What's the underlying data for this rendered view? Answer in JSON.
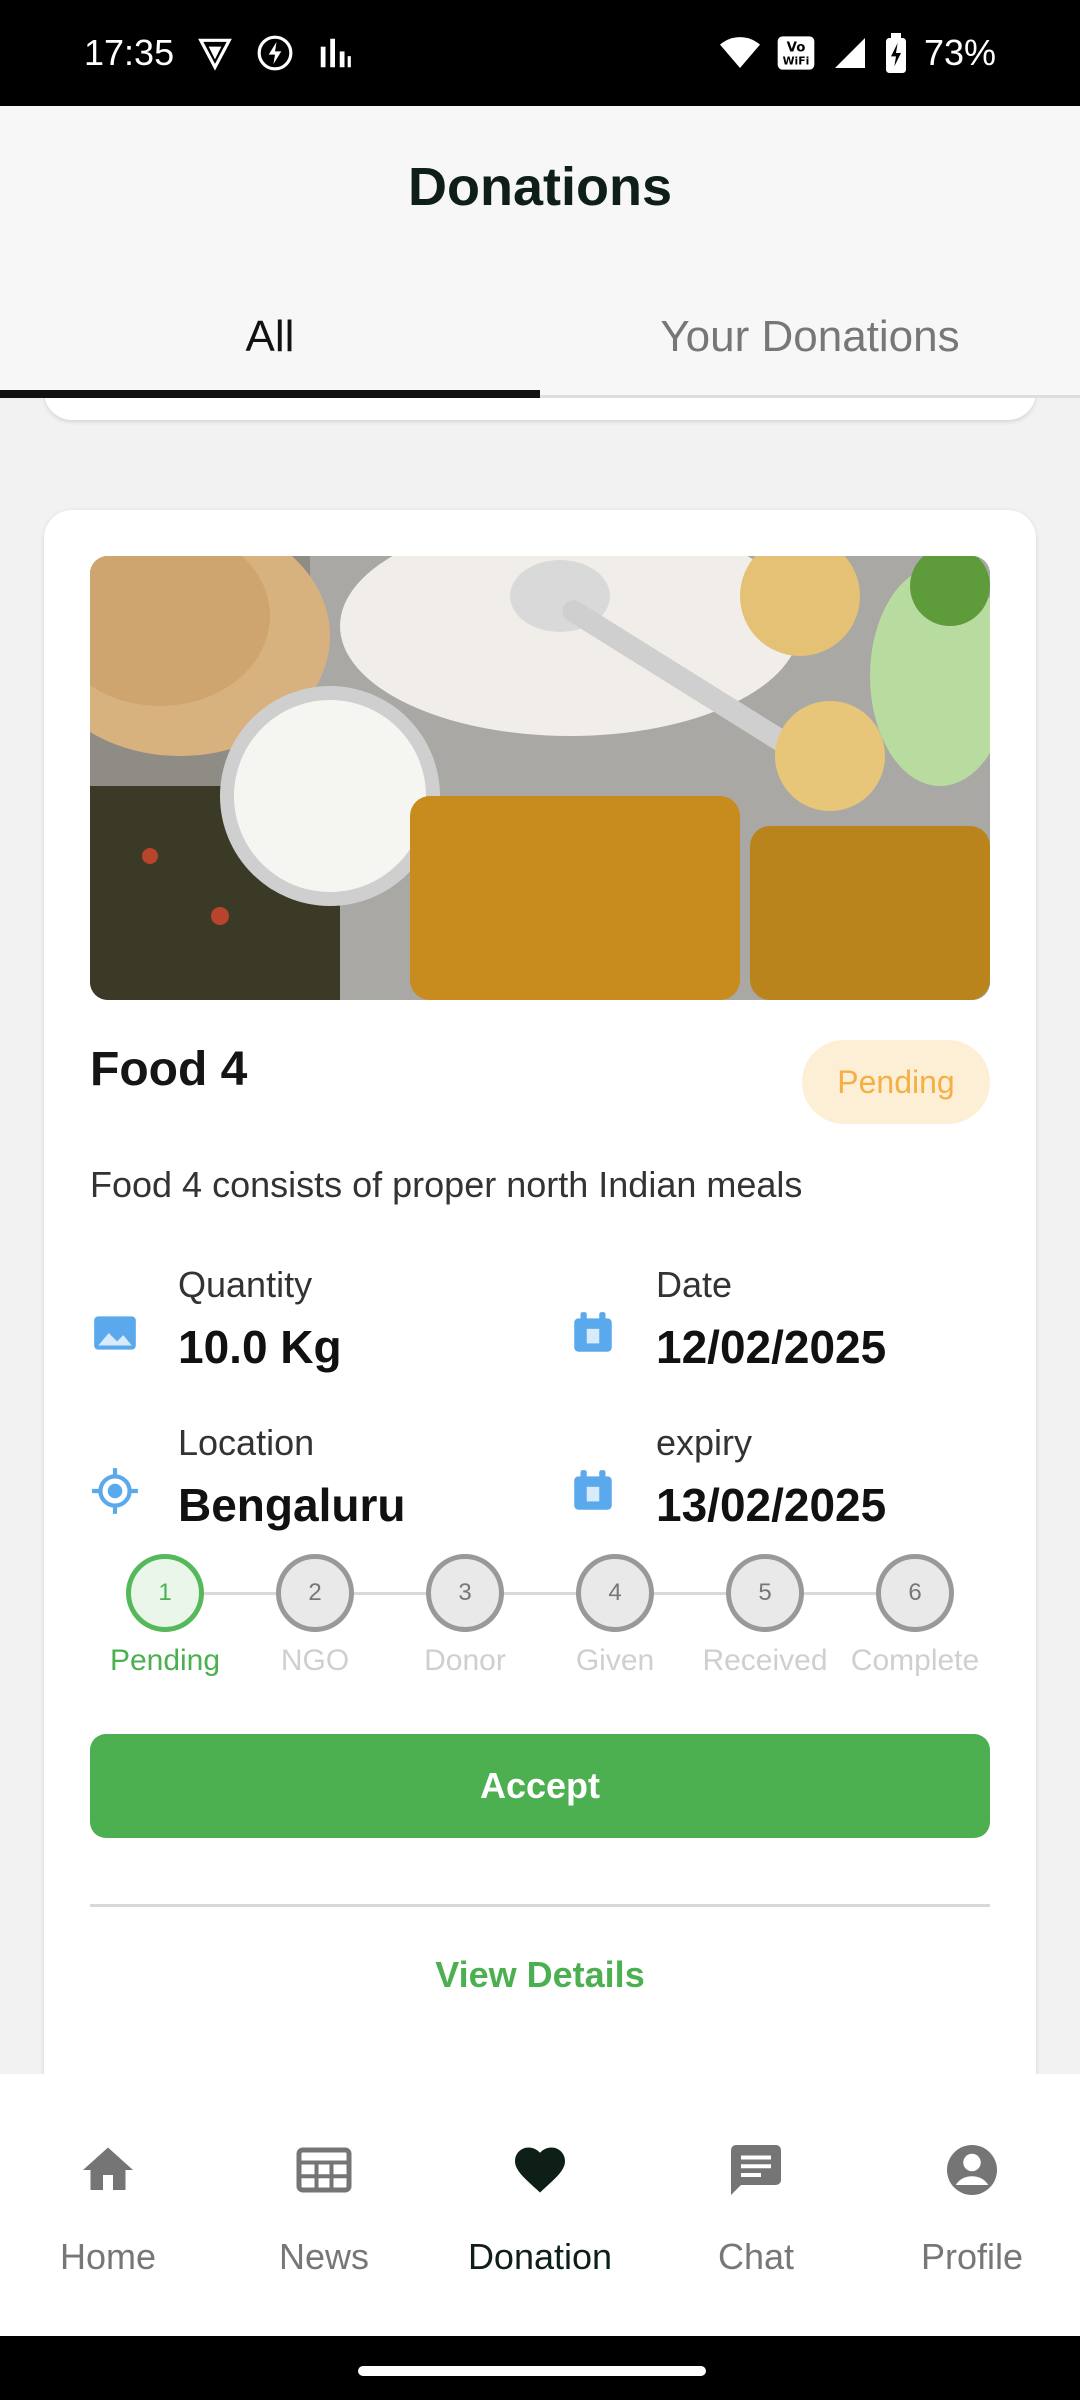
{
  "status_bar": {
    "time": "17:35",
    "battery": "73%",
    "left_icons": [
      "vpn-icon",
      "charging-flash-icon",
      "signal-bars-icon"
    ],
    "right_icons": [
      "wifi-icon",
      "vowifi-icon",
      "cell-signal-icon",
      "battery-icon"
    ],
    "vowifi_text": "Vo WiFi"
  },
  "header": {
    "title": "Donations"
  },
  "tabs": [
    {
      "label": "All",
      "active": true
    },
    {
      "label": "Your Donations",
      "active": false
    }
  ],
  "card": {
    "image_alt_icon": "food-thali-image",
    "title": "Food 4",
    "status_badge": "Pending",
    "description": "Food 4 consists of proper north Indian meals",
    "info": {
      "quantity": {
        "label": "Quantity",
        "value": "10.0 Kg",
        "icon": "image-icon"
      },
      "date": {
        "label": "Date",
        "value": "12/02/2025",
        "icon": "calendar-icon"
      },
      "location": {
        "label": "Location",
        "value": "Bengaluru",
        "icon": "location-target-icon"
      },
      "expiry": {
        "label": "expiry",
        "value": "13/02/2025",
        "icon": "calendar-icon"
      }
    },
    "stepper": [
      {
        "number": "1",
        "label": "Pending",
        "active": true
      },
      {
        "number": "2",
        "label": "NGO",
        "active": false
      },
      {
        "number": "3",
        "label": "Donor",
        "active": false
      },
      {
        "number": "4",
        "label": "Given",
        "active": false
      },
      {
        "number": "5",
        "label": "Received",
        "active": false
      },
      {
        "number": "6",
        "label": "Complete",
        "active": false
      }
    ],
    "accept_label": "Accept",
    "view_details_label": "View Details"
  },
  "bottom_nav": [
    {
      "label": "Home",
      "icon": "home-icon",
      "active": false
    },
    {
      "label": "News",
      "icon": "news-icon",
      "active": false
    },
    {
      "label": "Donation",
      "icon": "heart-icon",
      "active": true
    },
    {
      "label": "Chat",
      "icon": "chat-icon",
      "active": false
    },
    {
      "label": "Profile",
      "icon": "profile-icon",
      "active": false
    }
  ],
  "colors": {
    "accent_green": "#4caf50",
    "pending_badge_bg": "#fdeed6",
    "pending_badge_text": "#f4b043",
    "info_icon_blue": "#5aa9ec",
    "dark_text": "#0e1f17"
  }
}
